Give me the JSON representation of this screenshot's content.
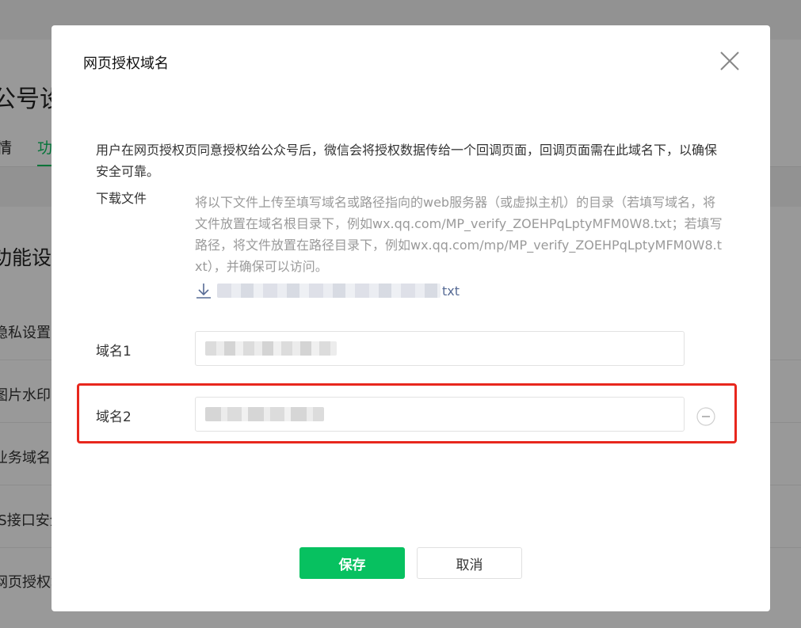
{
  "background": {
    "page_title": "公号设",
    "tabs": [
      {
        "label": "情",
        "active": false
      },
      {
        "label": "功",
        "active": true
      }
    ],
    "section_title": "功能设",
    "rows": [
      "隐私设置",
      "图片水印",
      "业务域名",
      "JS接口安全",
      "网页授权域"
    ]
  },
  "dialog": {
    "title": "网页授权域名",
    "close_icon": "close-icon",
    "description": "用户在网页授权页同意授权给公众号后，微信会将授权数据传给一个回调页面，回调页面需在此域名下，以确保安全可靠。",
    "download_label": "下载文件",
    "download_instructions": "将以下文件上传至填写域名或路径指向的web服务器（或虚拟主机）的目录（若填写域名，将文件放置在域名根目录下，例如wx.qq.com/MP_verify_ZOEHPqLptyMFM0W8.txt；若填写路径，将文件放置在路径目录下，例如wx.qq.com/mp/MP_verify_ZOEHPqLptyMFM0W8.txt），并确保可以访问。",
    "download_file_ext": "txt",
    "download_icon": "download-icon",
    "domain1_label": "域名1",
    "domain2_label": "域名2",
    "remove_icon": "minus-circle-icon",
    "save_label": "保存",
    "cancel_label": "取消"
  },
  "colors": {
    "primary_green": "#07c160",
    "highlight_red": "#e8271d",
    "link_blue": "#576b95"
  }
}
